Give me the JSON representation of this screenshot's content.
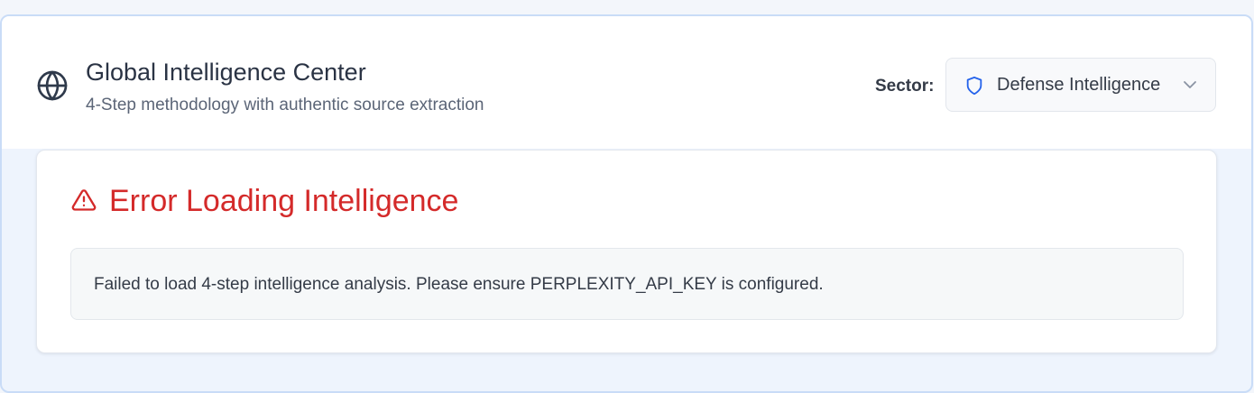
{
  "header": {
    "title": "Global Intelligence Center",
    "subtitle": "4-Step methodology with authentic source extraction",
    "icon": "globe-icon"
  },
  "sector": {
    "label": "Sector:",
    "selected": "Defense Intelligence",
    "icon": "shield-icon",
    "accent_color": "#2563eb"
  },
  "error": {
    "title": "Error Loading Intelligence",
    "message": "Failed to load 4-step intelligence analysis. Please ensure PERPLEXITY_API_KEY is configured.",
    "icon": "alert-triangle-icon",
    "color": "#d42a2a"
  }
}
